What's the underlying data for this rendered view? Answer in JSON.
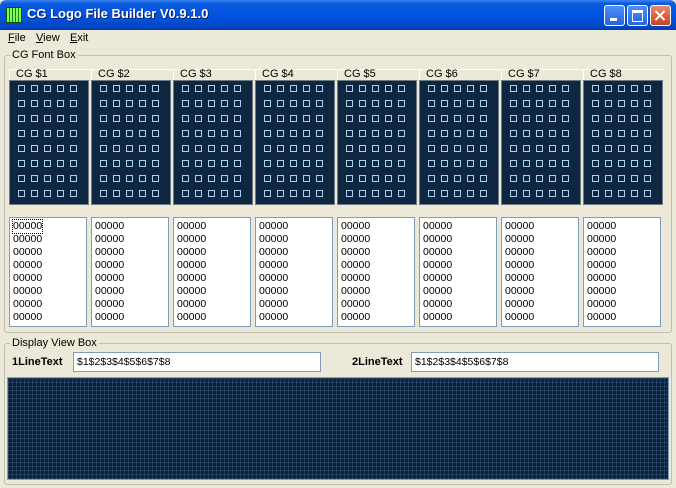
{
  "window": {
    "title": "CG Logo File Builder V0.9.1.0"
  },
  "menu": [
    {
      "ul": "F",
      "rest": "ile"
    },
    {
      "ul": "V",
      "rest": "iew"
    },
    {
      "ul": "E",
      "rest": "xit"
    }
  ],
  "font_box": {
    "label": "CG Font Box",
    "panels": [
      "CG $1",
      "CG $2",
      "CG $3",
      "CG $4",
      "CG $5",
      "CG $6",
      "CG $7",
      "CG $8"
    ],
    "grid": {
      "columns": 5,
      "rows": 8
    },
    "codes": [
      "00000",
      "00000",
      "00000",
      "00000",
      "00000",
      "00000",
      "00000",
      "00000"
    ]
  },
  "display_box": {
    "label": "Display View Box",
    "line1_label": "1LineText",
    "line1_value": "$1$2$3$4$5$6$7$8",
    "line2_label": "2LineText",
    "line2_value": "$1$2$3$4$5$6$7$8"
  },
  "colors": {
    "title_bar": "#0054e3",
    "grid_bg": "#0f2640",
    "cell_border": "#a8d0f0",
    "display_bg": "#0d2137"
  },
  "icons": {
    "app": "green-grid-icon",
    "min": "minimize-icon",
    "max": "maximize-icon",
    "close": "close-icon"
  }
}
